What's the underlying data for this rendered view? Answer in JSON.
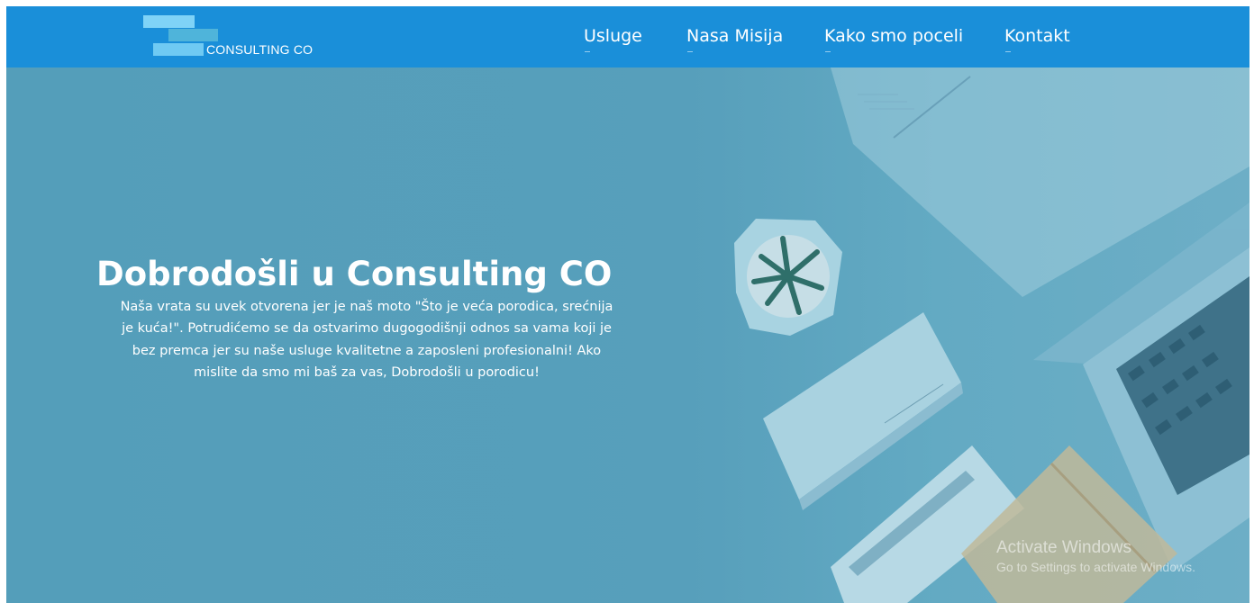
{
  "brand": {
    "logo_text": "CONSULTING CO"
  },
  "nav": {
    "items": [
      {
        "label": "Usluge"
      },
      {
        "label": "Nasa Misija"
      },
      {
        "label": "Kako smo poceli"
      },
      {
        "label": "Kontakt"
      }
    ]
  },
  "hero": {
    "title": "Dobrodošli u Consulting CO",
    "text": "Naša vrata su uvek otvorena jer je naš moto \"Što je veća porodica, srećnija je kuća!\". Potrudićemo se da ostvarimo dugogodišnji odnos sa vama koji je bez premca jer su naše usluge kvalitetne a zaposleni profesionalni! Ako mislite da smo mi baš za vas, Dobrodošli u porodicu!"
  },
  "watermark": {
    "line1": "Activate Windows",
    "line2": "Go to Settings to activate Windows."
  },
  "colors": {
    "navbar": "#1a8fd9",
    "hero_overlay": "#56a1bd",
    "logo_bars": [
      "#7fd3f7",
      "#4fb4da",
      "#6fcaf3"
    ]
  },
  "icons": {
    "hero_image": "office-desk-laptop-plant-illustration"
  }
}
